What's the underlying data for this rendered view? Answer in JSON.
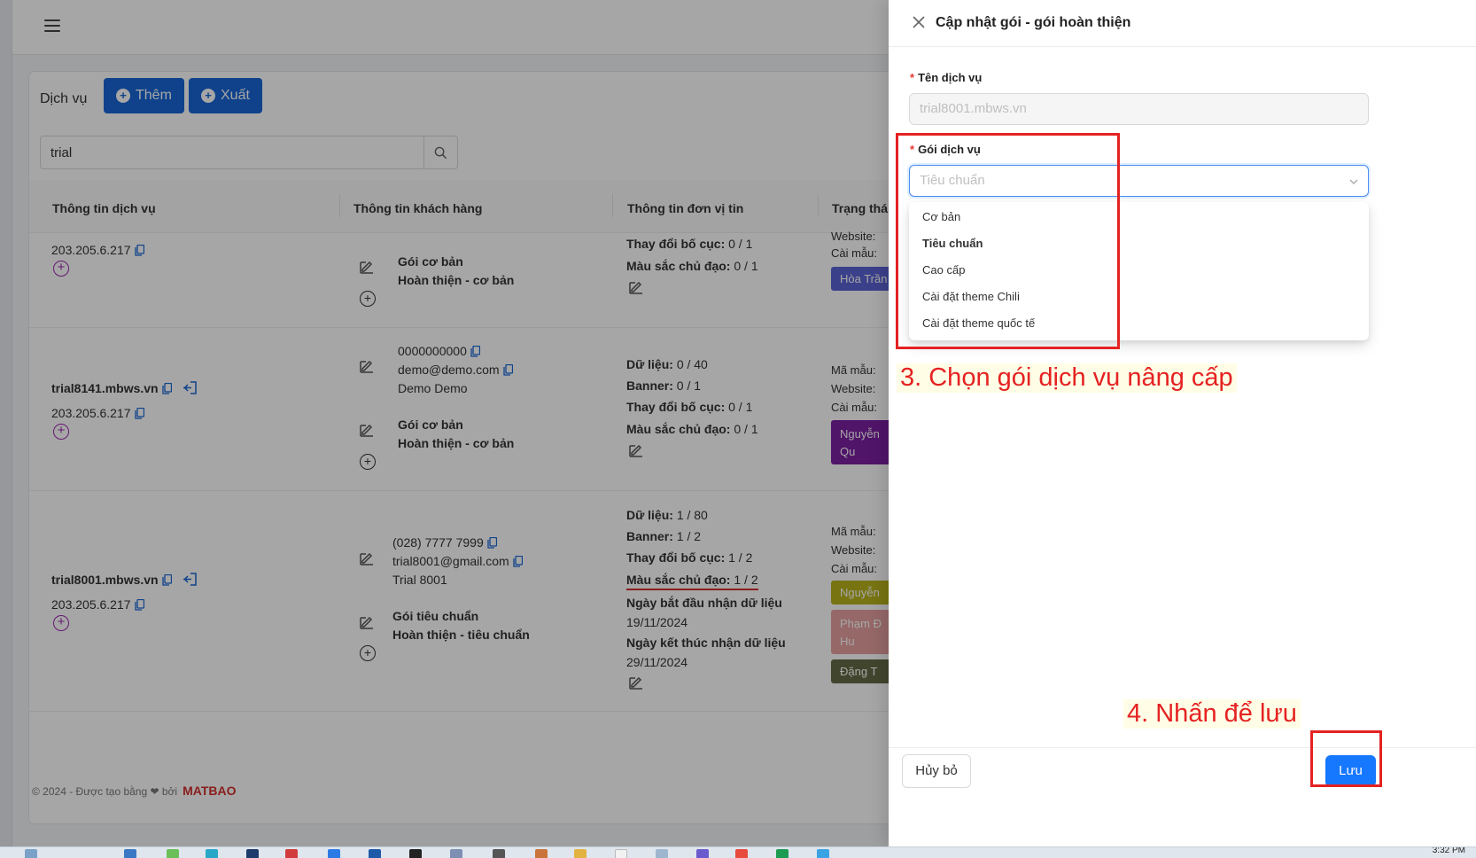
{
  "page": {
    "title": "Dịch vụ",
    "add_label": "Thêm",
    "export_label": "Xuất",
    "search_value": "trial"
  },
  "table": {
    "headers": [
      "Thông tin dịch vụ",
      "Thông tin khách hàng",
      "Thông tin đơn vị tin",
      "Trạng thái"
    ],
    "rows": [
      {
        "domain": "",
        "ip": "203.205.6.217",
        "package_name": "Gói cơ bản",
        "package_detail": "Hoàn thiện - cơ bản",
        "unit_info": [
          {
            "label": "Thay đổi bố cục:",
            "value": "0 / 1"
          },
          {
            "label": "Màu sắc chủ đạo:",
            "value": "0 / 1"
          }
        ],
        "status_lines": [
          "Website:",
          "Cài mẫu:"
        ],
        "status_buttons": [
          "Hòa Trần"
        ]
      },
      {
        "domain": "trial8141.mbws.vn",
        "ip": "203.205.6.217",
        "phone": "0000000000",
        "email": "demo@demo.com",
        "customer_name": "Demo Demo",
        "package_name": "Gói cơ bản",
        "package_detail": "Hoàn thiện - cơ bản",
        "unit_info": [
          {
            "label": "Dữ liệu:",
            "value": "0 / 40"
          },
          {
            "label": "Banner:",
            "value": "0 / 1"
          },
          {
            "label": "Thay đổi bố cục:",
            "value": "0 / 1"
          },
          {
            "label": "Màu sắc chủ đạo:",
            "value": "0 / 1"
          }
        ],
        "status_lines": [
          "Mã mẫu:",
          "Website:",
          "Cài mẫu:"
        ],
        "status_buttons": [
          "Nguyễn Qu"
        ]
      },
      {
        "domain": "trial8001.mbws.vn",
        "ip": "203.205.6.217",
        "phone": "(028) 7777 7999",
        "email": "trial8001@gmail.com",
        "customer_name": "Trial 8001",
        "package_name": "Gói tiêu chuẩn",
        "package_detail": "Hoàn thiện - tiêu chuẩn",
        "unit_info": [
          {
            "label": "Dữ liệu:",
            "value": "1 / 80"
          },
          {
            "label": "Banner:",
            "value": "1 / 2"
          },
          {
            "label": "Thay đổi bố cục:",
            "value": "1 / 2"
          },
          {
            "label": "Màu sắc chủ đạo:",
            "value": "1 / 2"
          }
        ],
        "start_label": "Ngày bắt đầu nhận dữ liệu",
        "start_date": "19/11/2024",
        "end_label": "Ngày kết thúc nhận dữ liệu",
        "end_date": "29/11/2024",
        "status_lines": [
          "Mã mẫu:",
          "Website:",
          "Cài mẫu:"
        ],
        "status_buttons": [
          "Nguyễn",
          "Phạm Đ Hu",
          "Đặng T"
        ]
      }
    ]
  },
  "footer": {
    "copyright": "© 2024 - Được tạo bằng ❤ bởi",
    "logo": "MATBAO"
  },
  "drawer": {
    "title": "Cập nhật gói - gói hoàn thiện",
    "service_name_label": "Tên dịch vụ",
    "service_name_value": "trial8001.mbws.vn",
    "package_label": "Gói dịch vụ",
    "package_placeholder": "Tiêu chuẩn",
    "options": [
      "Cơ bản",
      "Tiêu chuẩn",
      "Cao cấp",
      "Cài đặt theme Chili",
      "Cài đặt theme quốc tế"
    ],
    "selected_option": "Tiêu chuẩn",
    "cancel_label": "Hủy bỏ",
    "save_label": "Lưu"
  },
  "annotations": {
    "step3": "3. Chọn gói dịch vụ nâng cấp",
    "step4": "4. Nhấn để lưu"
  },
  "taskbar": {
    "clock": "3:32 PM"
  },
  "colors": {
    "primary": "#1766d6",
    "annotation": "#e52222",
    "purple": "#9c27b0"
  }
}
